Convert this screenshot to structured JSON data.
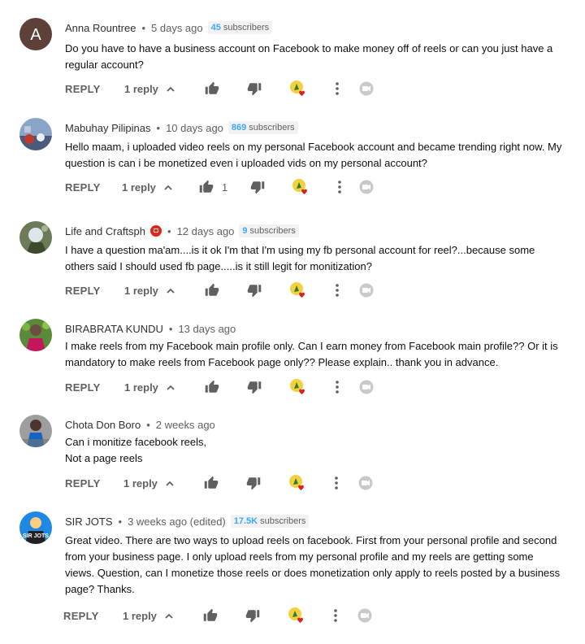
{
  "comments": [
    {
      "author": "Anna Rountree",
      "time": "5 days ago",
      "badge_count": "45",
      "badge_label": "subscribers",
      "text_lines": [
        "Do you have to have a business account on Facebook to make money off of reels or can you just have a",
        "regular account?"
      ],
      "reply_label": "REPLY",
      "replies": "1 reply",
      "likes": "",
      "avatar_letter": "A"
    },
    {
      "author": "Mabuhay Pilipinas",
      "time": "10 days ago",
      "badge_count": "869",
      "badge_label": "subscribers",
      "text_lines": [
        "Hello maam, i uploaded video reels on my personal Facebook account and became trending right now. My",
        "question is can i be monetized even i uploaded vids on my personal account?"
      ],
      "reply_label": "REPLY",
      "replies": "1 reply",
      "likes": "1"
    },
    {
      "author": "Life and Craftsph",
      "time": "12 days ago",
      "badge_count": "9",
      "badge_label": "subscribers",
      "text_lines": [
        "I have a question ma'am....is it ok I'm that I'm using my fb personal account for reel?...because some",
        "others said I should used fb page.....is it still legit for monitization?"
      ],
      "reply_label": "REPLY",
      "replies": "1 reply",
      "likes": ""
    },
    {
      "author": "BIRABRATA KUNDU",
      "time": "13 days ago",
      "text_lines": [
        "I make reels from my Facebook main profile only. Can I earn money from Facebook main profile?? Or it is",
        "mandatory to make reels from Facebook page only?? Please explain.. thank you in advance."
      ],
      "reply_label": "REPLY",
      "replies": "1 reply",
      "likes": ""
    },
    {
      "author": "Chota Don Boro",
      "time": "2 weeks ago",
      "text_lines": [
        "Can i monitize facebook reels,",
        "Not a page reels"
      ],
      "reply_label": "REPLY",
      "replies": "1 reply",
      "likes": ""
    },
    {
      "author": "SIR JOTS",
      "time": "3 weeks ago (edited)",
      "badge_count": "17.5K",
      "badge_label": "subscribers",
      "avatar_text": "SIR JOTS",
      "text_lines": [
        "Great video. There are two ways to upload reels on facebook. First from your personal profile and second",
        "from your business page. I only upload reels from my personal profile and my reels are getting some",
        "views. Question, can I monetize those reels or does monetization only apply to reels posted by a business",
        "page? Thanks."
      ],
      "reply_label": "REPLY",
      "replies": "1 reply",
      "likes": ""
    }
  ],
  "separator": "•",
  "chevron": "^",
  "colors": {
    "badge_count": "#3ea6ff",
    "owner_badge": "#e62117",
    "muted": "#606060",
    "heart": "#d9241b"
  },
  "icons": [
    "avatar",
    "thumbs-up-icon",
    "thumbs-down-icon",
    "creator-heart-icon",
    "more-vert-icon",
    "promote-icon",
    "chevron-up-icon",
    "owner-badge-icon"
  ]
}
